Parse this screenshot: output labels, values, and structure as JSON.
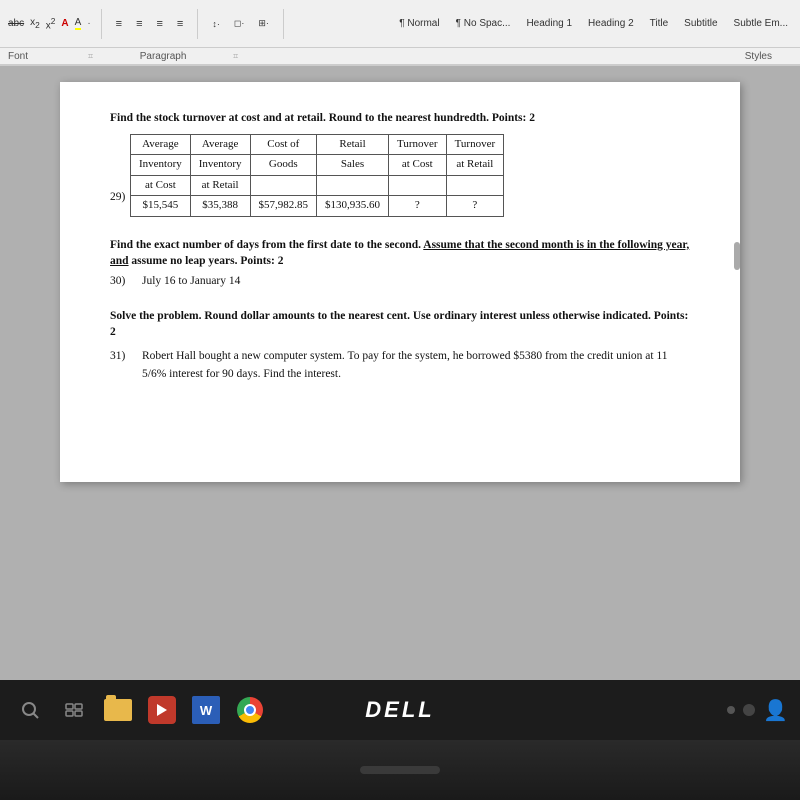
{
  "toolbar": {
    "font_label": "Font",
    "paragraph_label": "Paragraph",
    "styles_label": "Styles",
    "styles_items": [
      "¶ Normal",
      "¶ No Spac...",
      "Heading 1",
      "Heading 2",
      "Title",
      "Subtitle",
      "Subtle Em..."
    ],
    "font_controls": [
      "A",
      "x₂",
      "x²",
      "A⁻",
      "A·"
    ]
  },
  "document": {
    "q29_instruction": "Find the stock turnover at cost and at retail. Round to the nearest hundredth. Points: 2",
    "table": {
      "headers": [
        [
          "Average",
          "Average",
          "Cost of",
          "Retail",
          "Turnover",
          "Turnover"
        ],
        [
          "Inventory",
          "Inventory",
          "Goods",
          "Sales",
          "at Cost",
          "at Retail"
        ],
        [
          "at Cost",
          "at Retail",
          "",
          "",
          "",
          ""
        ]
      ],
      "row_number": "29)",
      "values": [
        "$15,545",
        "$35,388",
        "$57,982.85",
        "$130,935.60",
        "?",
        "?"
      ]
    },
    "q30_instruction": "Find the exact number of days from the first date to the second.",
    "q30_underline": "Assume that the second month is in the following year, and",
    "q30_rest": " assume no leap years. Points: 2",
    "q30_number": "30)",
    "q30_problem": "July 16 to January 14",
    "q31_instruction": "Solve the problem. Round dollar amounts to the nearest cent. Use ordinary interest unless otherwise indicated. Points: 2",
    "q31_number": "31)",
    "q31_problem": "Robert Hall bought a new computer system. To pay for the system, he borrowed $5380 from the credit union at 11 5/6% interest for 90 days. Find the interest."
  },
  "taskbar": {
    "dell_label": "DELL",
    "taskbar_icons": [
      "cortana",
      "task-view",
      "file-explorer",
      "iina",
      "word",
      "chrome"
    ]
  }
}
